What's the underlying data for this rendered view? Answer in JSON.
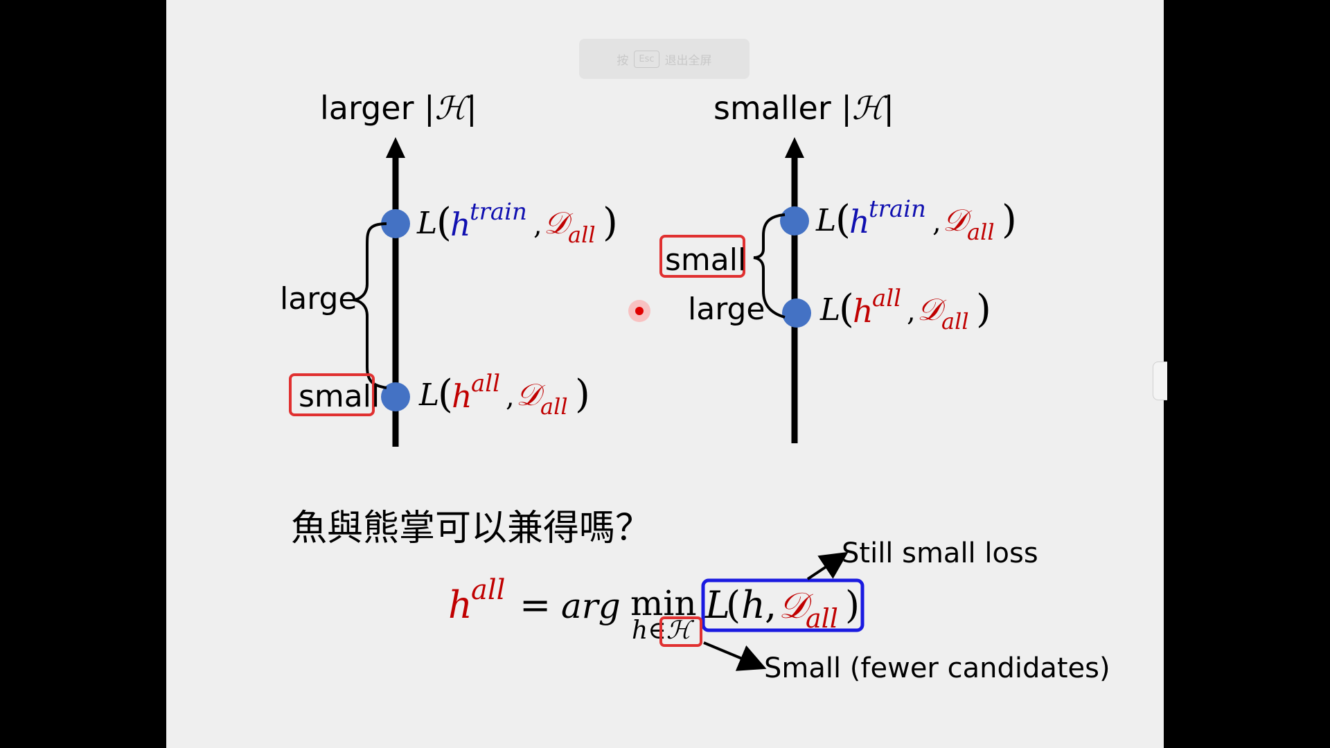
{
  "overlay": {
    "press": "按",
    "key": "Esc",
    "exit": "退出全屏"
  },
  "left": {
    "title_word": "larger",
    "hyp": "ℋ",
    "top_L": "L",
    "top_h": "h",
    "top_sup": "train",
    "D": "𝒟",
    "sub": "all",
    "bot_sup": "all",
    "brace_label": "large",
    "boxed_label": "small"
  },
  "right": {
    "title_word": "smaller",
    "hyp": "ℋ",
    "top_sup": "train",
    "bot_sup": "all",
    "brace_label_boxed": "small",
    "gap_label": "large"
  },
  "question": "魚與熊掌可以兼得嗎？",
  "equation": {
    "h": "h",
    "sup": "all",
    "eq": "=",
    "arg": "arg",
    "min": "min",
    "under": "h∈ℋ",
    "L": "L",
    "h2": "h",
    "D": "𝒟",
    "sub": "all"
  },
  "annotations": {
    "loss_note": "Still small loss",
    "cand_note": "Small (fewer candidates)"
  },
  "colors": {
    "blue": "#1010b0",
    "red": "#c00000",
    "dot": "#4472c4",
    "box_red": "#e03030",
    "box_blue": "#1a1ae0"
  }
}
